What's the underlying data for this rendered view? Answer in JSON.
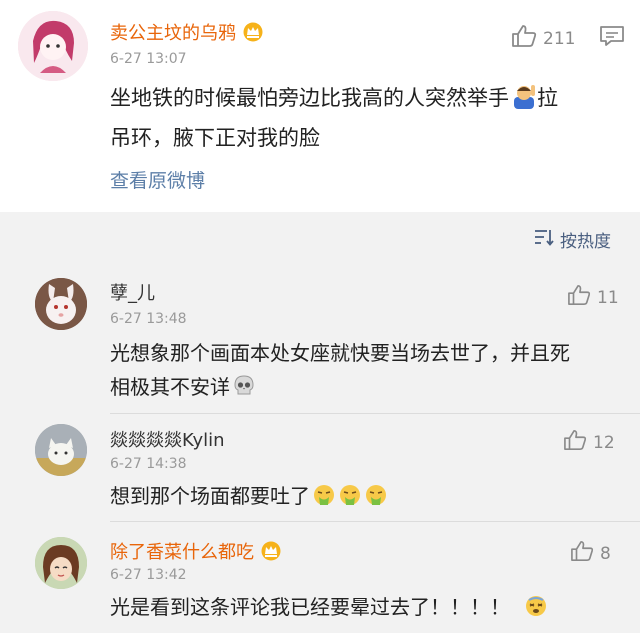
{
  "post": {
    "username": "卖公主坟的乌鸦",
    "time": "6-27 13:07",
    "likes": "211",
    "text_line1": "坐地铁的时候最怕旁边比我高的人突然举手",
    "text_line1_tail": "拉",
    "text_line2": "吊环，腋下正对我的脸",
    "view_original": "查看原微博"
  },
  "sort_label": "按热度",
  "comments": [
    {
      "username": "孽_儿",
      "time": "6-27 13:48",
      "likes": "11",
      "line1": "光想象那个画面本处女座就快要当场去世了，并且死",
      "line2": "相极其不安详"
    },
    {
      "username": "燚燚燚燚Kylin",
      "time": "6-27 14:38",
      "likes": "12",
      "line1": "想到那个场面都要吐了"
    },
    {
      "username": "除了香菜什么都吃",
      "time": "6-27 13:42",
      "likes": "8",
      "line1": "光是看到这条评论我已经要晕过去了！！！！"
    }
  ],
  "colors": {
    "orange_name": "#e8650a",
    "link": "#5d7fa8",
    "background": "#f2f2f2"
  },
  "icons": [
    "crown-badge-icon",
    "thumbs-up-icon",
    "comment-icon",
    "sort-icon",
    "raising-hand-emoji",
    "skull-emoji",
    "vomit-emoji",
    "dizzy-emoji"
  ]
}
